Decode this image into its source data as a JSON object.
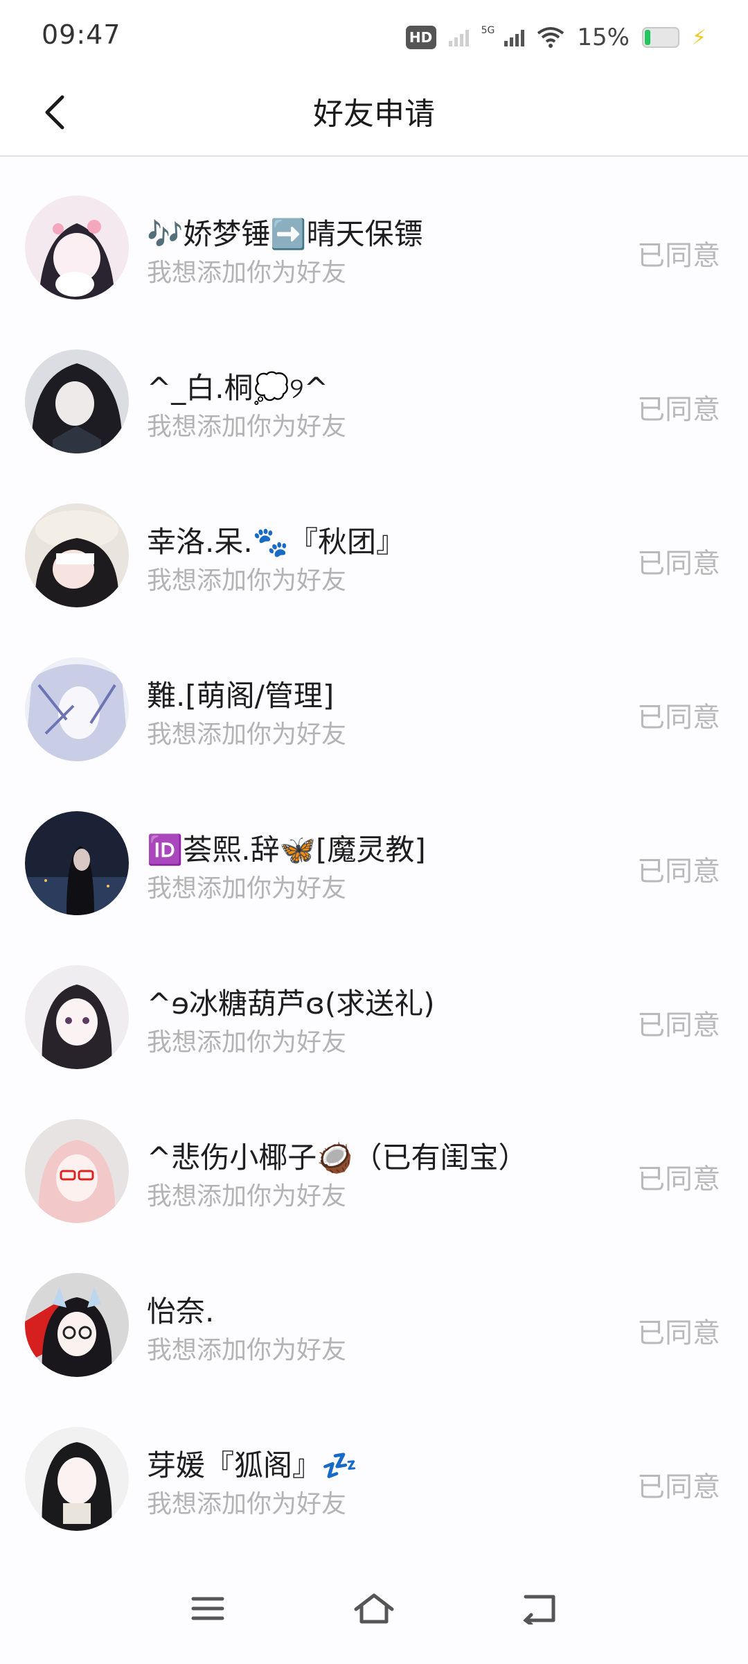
{
  "status_bar": {
    "time": "09:47",
    "hd_label": "HD",
    "network_label": "5G",
    "battery_percent": "15%",
    "battery_level": 0.15,
    "icons": [
      "hd-icon",
      "signal-icon",
      "wifi-icon",
      "battery-icon",
      "charging-icon"
    ]
  },
  "header": {
    "title": "好友申请",
    "back_icon": "back-arrow-icon"
  },
  "requests": [
    {
      "name": "🎶娇梦锤➡️晴天保镖",
      "message": "我想添加你为好友",
      "status": "已同意"
    },
    {
      "name": "^_白.桐💭୨^",
      "message": "我想添加你为好友",
      "status": "已同意"
    },
    {
      "name": "幸洛.呆.🐾『秋团』",
      "message": "我想添加你为好友",
      "status": "已同意"
    },
    {
      "name": "難.[萌阁/管理]",
      "message": "我想添加你为好友",
      "status": "已同意"
    },
    {
      "name": "🆔荟熙.辞🦋[魔灵教]",
      "message": "我想添加你为好友",
      "status": "已同意"
    },
    {
      "name": "^ɘ冰糖葫芦ɞ(求送礼)",
      "message": "我想添加你为好友",
      "status": "已同意"
    },
    {
      "name": "^悲伤小椰子🥥（已有闺宝）",
      "message": "我想添加你为好友",
      "status": "已同意"
    },
    {
      "name": "怡奈.",
      "message": "我想添加你为好友",
      "status": "已同意"
    },
    {
      "name": "芽媛『狐阁』💤",
      "message": "我想添加你为好友",
      "status": "已同意"
    }
  ],
  "nav_bar": {
    "icons": [
      "menu-icon",
      "home-icon",
      "back-icon"
    ]
  },
  "colors": {
    "background": "#fdfcfe",
    "status_text": "#b9b9b9",
    "message_text": "#b3b3b3",
    "battery_fill": "#22c55e",
    "charging": "#f3c623"
  }
}
